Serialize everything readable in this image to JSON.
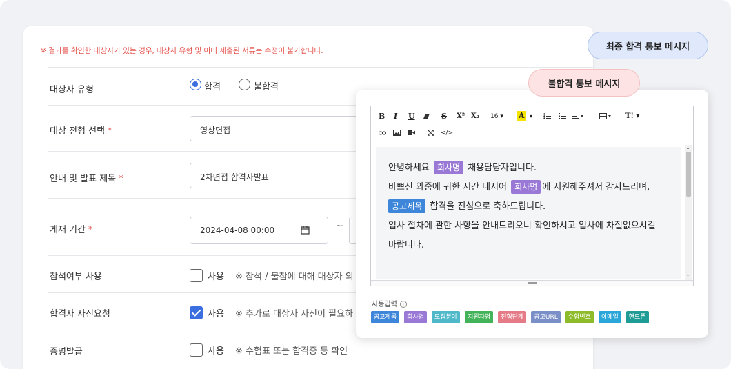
{
  "notice": "※ 결과를 확인한 대상자가 있는 경우, 대상자 유형 및 이미 제출된 서류는 수정이 불가합니다.",
  "rows": {
    "target_type": {
      "label": "대상자 유형",
      "options": [
        "합격",
        "불합격"
      ],
      "selected": "합격"
    },
    "stage_select": {
      "label": "대상 전형 선택",
      "value": "영상면접"
    },
    "title": {
      "label": "안내 및 발표 제목",
      "value": "2차면접 합격자발표"
    },
    "period": {
      "label": "게재 기간",
      "start": "2024-04-08 00:00",
      "separator": "~"
    },
    "attendance": {
      "label": "참석여부 사용",
      "check_label": "사용",
      "checked": false,
      "note": "※ 참석 / 불참에 대해 대상자 의"
    },
    "photo": {
      "label": "합격자 사진요청",
      "check_label": "사용",
      "checked": true,
      "note": "※ 추가로 대상자 사진이 필요하"
    },
    "certificate": {
      "label": "증명발급",
      "check_label": "사용",
      "checked": false,
      "note": "※ 수험표 또는 합격증 등 확인"
    }
  },
  "required_mark": "*",
  "pills": {
    "final": "최종 합격 통보 메시지",
    "fail": "불합격 통보 메시지"
  },
  "toolbar": {
    "bold": "B",
    "italic": "I",
    "underline": "U",
    "strike": "S",
    "superscript": "X²",
    "subscript": "X₂",
    "font_size": "16",
    "font_color": "A",
    "html": "</>"
  },
  "message": {
    "line1_pre": "안녕하세요",
    "tag_company": "회사명",
    "line1_post": "채용담당자입니다.",
    "line2_pre": "바쁘신 와중에 귀한 시간 내시어",
    "line2_post": "에 지원해주셔서 감사드리며,",
    "tag_posting": "공고제목",
    "line3_post": "합격을 진심으로 축하드립니다.",
    "line4": "입사 절차에 관한 사항을 안내드리오니 확인하시고 입사에 차질없으시길",
    "line5": "바랍니다."
  },
  "auto_input": {
    "label": "자동입력",
    "chips": [
      {
        "text": "공고제목",
        "color": "#3d86d9"
      },
      {
        "text": "회사명",
        "color": "#9a79d6"
      },
      {
        "text": "모집분야",
        "color": "#4fb8c9"
      },
      {
        "text": "지원자명",
        "color": "#43b35a"
      },
      {
        "text": "전형단계",
        "color": "#e57b86"
      },
      {
        "text": "공고URL",
        "color": "#7a8ec7"
      },
      {
        "text": "수험번호",
        "color": "#8dbb2a"
      },
      {
        "text": "이메일",
        "color": "#2aa6d8"
      },
      {
        "text": "핸드폰",
        "color": "#1f9c96"
      }
    ]
  },
  "colors": {
    "accent": "#3b6fe0",
    "required": "#e5554f",
    "tag_company": "#9a79d6",
    "tag_posting": "#3d86d9"
  }
}
